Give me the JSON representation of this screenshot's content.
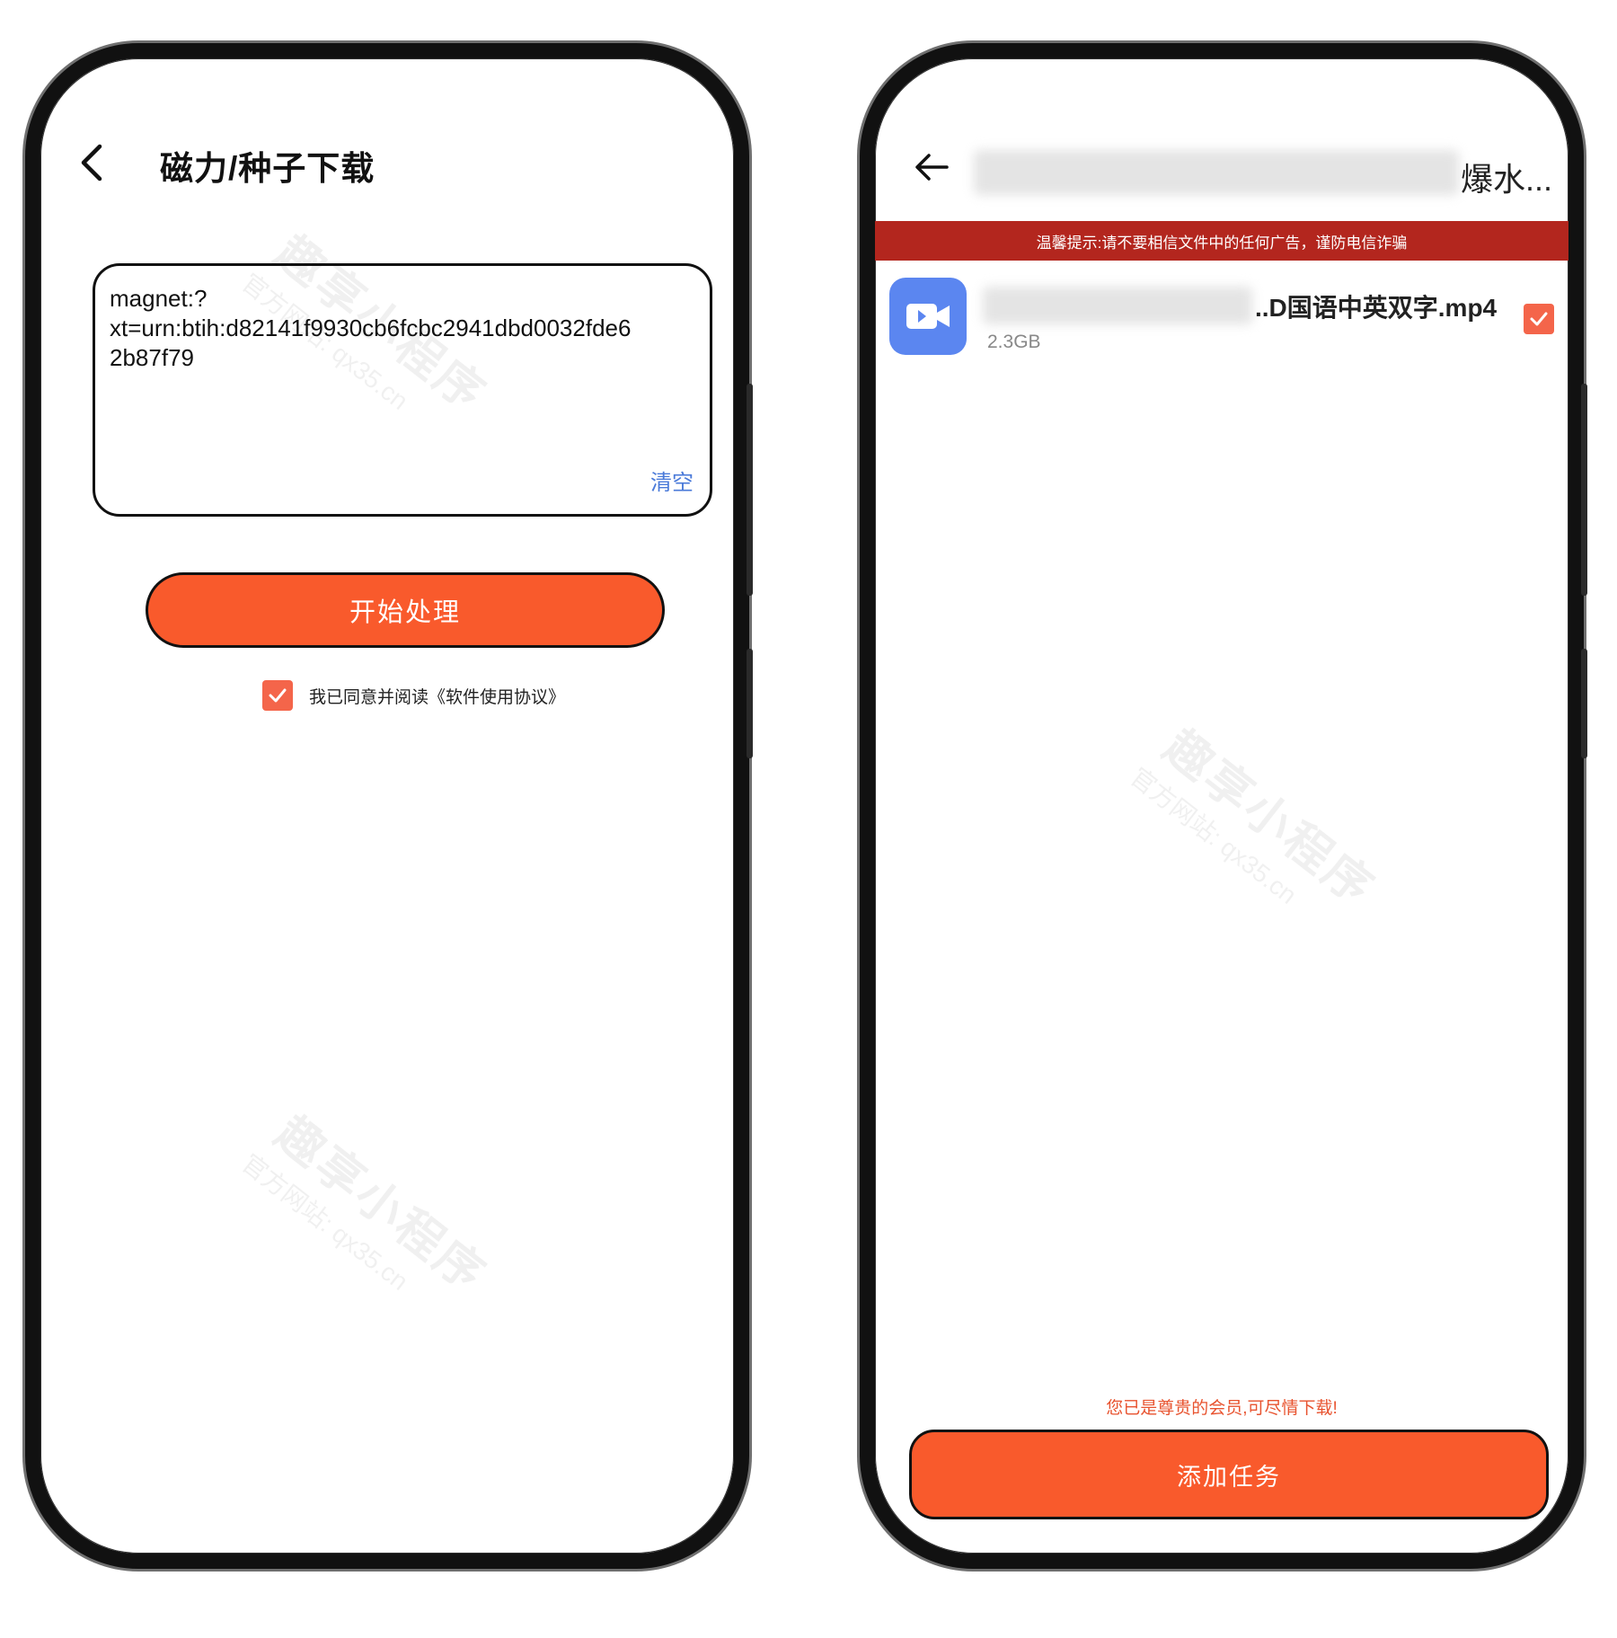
{
  "left": {
    "title": "磁力/种子下载",
    "magnet_text": "magnet:?\nxt=urn:btih:d82141f9930cb6fcbc2941dbd0032fde6\n2b87f79",
    "clear_label": "清空",
    "start_button": "开始处理",
    "agree_checked": true,
    "agree_text": "我已同意并阅读《软件使用协议》"
  },
  "right": {
    "title_visible_tail": "爆水...",
    "warning_banner": "温馨提示:请不要相信文件中的任何广告，谨防电信诈骗",
    "file": {
      "name_visible_tail": "..D国语中英双字.mp4",
      "size": "2.3GB",
      "checked": true,
      "icon": "video-camera-icon"
    },
    "vip_note": "您已是尊贵的会员,可尽情下载!",
    "add_button": "添加任务"
  },
  "watermark": {
    "main": "趣享小程序",
    "sub": "官方网站: qx35.cn"
  },
  "colors": {
    "accent_orange": "#f95a2c",
    "checkbox_red": "#f4654a",
    "banner_red": "#b3261e",
    "link_blue": "#4a7ad9",
    "file_icon_blue": "#5b86f0",
    "vip_text": "#e8532f"
  }
}
